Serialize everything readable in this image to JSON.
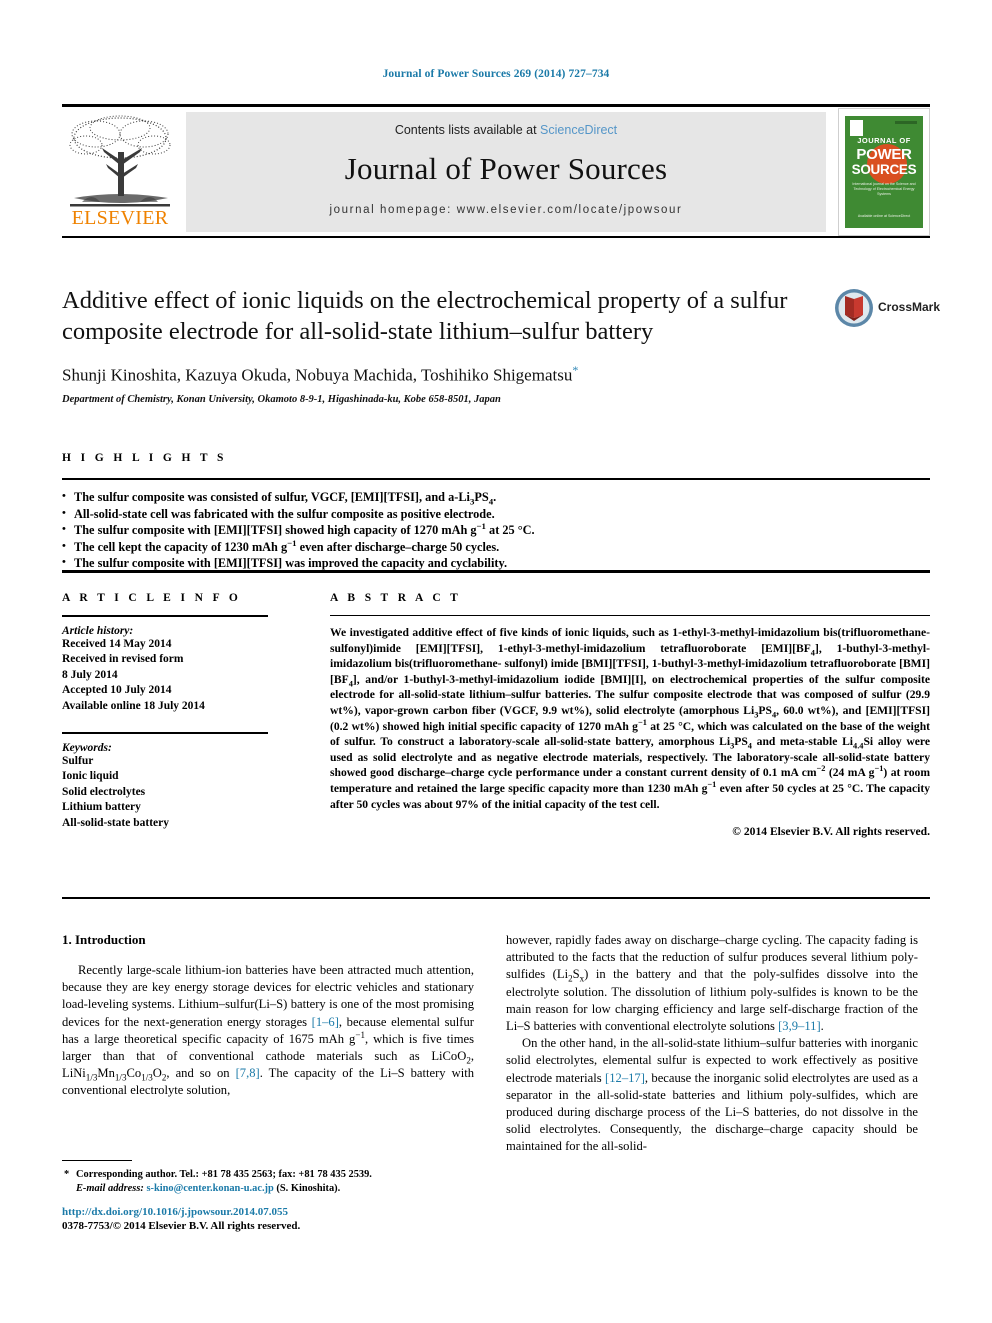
{
  "running_head": "Journal of Power Sources 269 (2014) 727–734",
  "masthead": {
    "publisher_name": "ELSEVIER",
    "contents_prefix": "Contents lists available at",
    "sciencedirect": "ScienceDirect",
    "journal_name": "Journal of Power Sources",
    "homepage": "journal homepage: www.elsevier.com/locate/jpowsour",
    "cover": {
      "line1": "JOURNAL OF",
      "line2": "POWER",
      "line3": "SOURCES",
      "subtitle": "International journal on the Science and Technology of Electrochemical Energy Systems",
      "footer": "Available online at\nScienceDirect"
    }
  },
  "article": {
    "title": "Additive effect of ionic liquids on the electrochemical property of a sulfur composite electrode for all-solid-state lithium–sulfur battery",
    "authors": "Shunji Kinoshita, Kazuya Okuda, Nobuya Machida, Toshihiko Shigematsu",
    "affiliation": "Department of Chemistry, Konan University, Okamoto 8-9-1, Higashinada-ku, Kobe 658-8501, Japan",
    "crossmark_label": "CrossMark"
  },
  "highlights": {
    "heading": "H I G H L I G H T S",
    "items": [
      "The sulfur composite was consisted of sulfur, VGCF, [EMI][TFSI], and a-Li3PS4.",
      "All-solid-state cell was fabricated with the sulfur composite as positive electrode.",
      "The sulfur composite with [EMI][TFSI] showed high capacity of 1270 mAh g−1 at 25 °C.",
      "The cell kept the capacity of 1230 mAh g−1 even after discharge–charge 50 cycles.",
      "The sulfur composite with [EMI][TFSI] was improved the capacity and cyclability."
    ]
  },
  "article_info": {
    "heading": "A R T I C L E  I N F O",
    "history_label": "Article history:",
    "history": [
      "Received 14 May 2014",
      "Received in revised form",
      "8 July 2014",
      "Accepted 10 July 2014",
      "Available online 18 July 2014"
    ],
    "keywords_label": "Keywords:",
    "keywords": [
      "Sulfur",
      "Ionic liquid",
      "Solid electrolytes",
      "Lithium battery",
      "All-solid-state battery"
    ]
  },
  "abstract": {
    "heading": "A B S T R A C T",
    "copyright": "© 2014 Elsevier B.V. All rights reserved."
  },
  "introduction": {
    "section_number_title": "1.  Introduction"
  },
  "footnote": {
    "corresponding": "Corresponding author. Tel.: +81 78 435 2563; fax: +81 78 435 2539.",
    "email_label": "E-mail address:",
    "email": "s-kino@center.konan-u.ac.jp",
    "email_owner": "(S. Kinoshita)."
  },
  "page_footer": {
    "doi": "http://dx.doi.org/10.1016/j.jpowsour.2014.07.055",
    "issn": "0378-7753/© 2014 Elsevier B.V. All rights reserved."
  },
  "colors": {
    "link": "#1b7aa8",
    "sciencedirect": "#5596c8",
    "elsevier_orange": "#ef8200",
    "cover_green": "#3f8a33",
    "band_gray": "#e6e6e6"
  }
}
